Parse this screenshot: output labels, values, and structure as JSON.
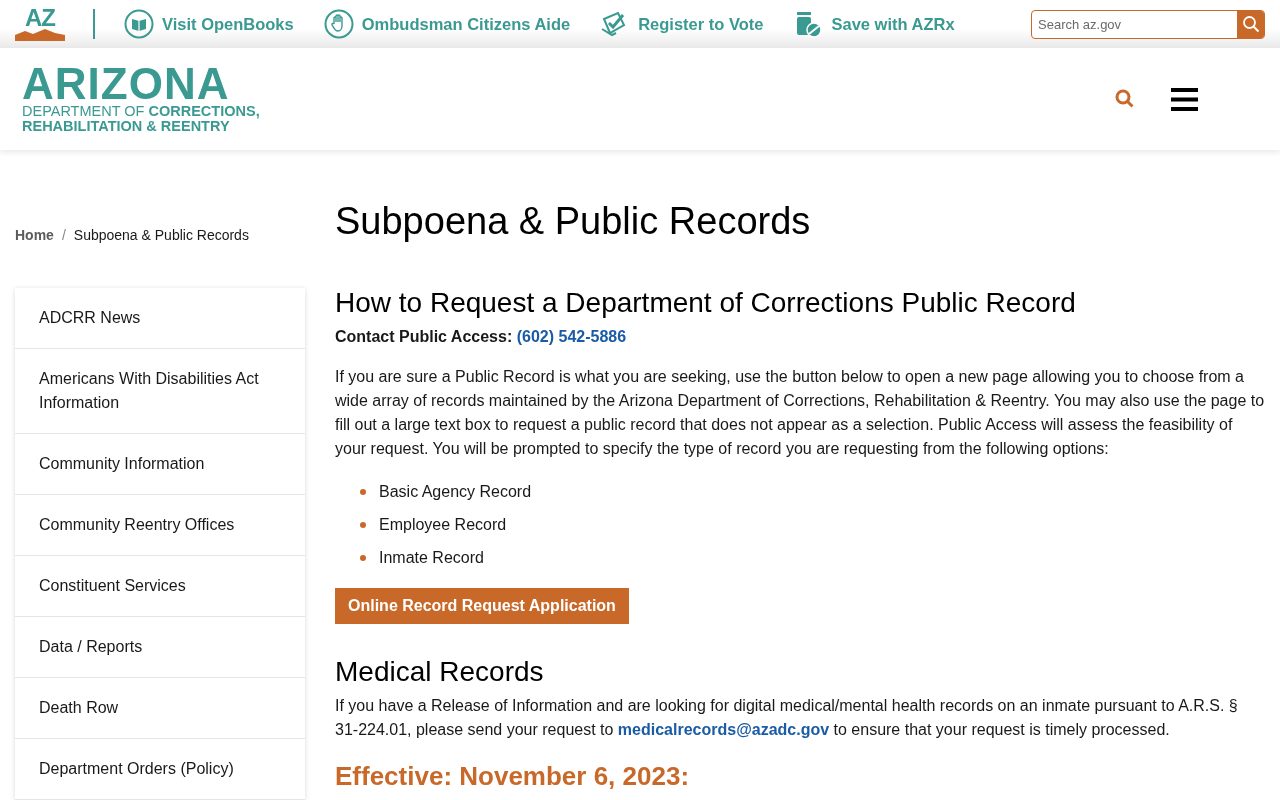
{
  "top_bar": {
    "logo": "AZ",
    "links": [
      {
        "label": "Visit OpenBooks",
        "kind": "book"
      },
      {
        "label": "Ombudsman Citizens Aide",
        "kind": "hand"
      },
      {
        "label": "Register to Vote",
        "kind": "vote"
      },
      {
        "label": "Save with AZRx",
        "kind": "pill"
      }
    ],
    "search": {
      "placeholder": "Search az.gov"
    }
  },
  "header": {
    "logo": {
      "name": "ARIZONA",
      "line_1_light": "DEPARTMENT OF",
      "line_1_bold": "CORRECTIONS,",
      "line_2": "REHABILITATION & REENTRY"
    }
  },
  "breadcrumb": [
    {
      "label": "Home",
      "kind": "link"
    },
    {
      "label": "/",
      "kind": "separator"
    },
    {
      "label": "Subpoena & Public Records",
      "kind": "current"
    }
  ],
  "sidebar": {
    "items": [
      "ADCRR News",
      "Americans With Disabilities Act Information",
      "Community Information",
      "Community Reentry Offices",
      "Constituent Services",
      "Data / Reports",
      "Death Row",
      "Department Orders (Policy)"
    ]
  },
  "main": {
    "title": "Subpoena & Public Records",
    "sections": [
      {
        "heading": "How to Request a Department of Corrections Public Record",
        "contact_label": "Contact Public Access:",
        "contact_link": "(602) 542-5886",
        "paragraph": "If you are sure a Public Record is what you are seeking, use the button below to open a new page allowing you to choose from a wide array of records maintained by the Arizona Department of Corrections, Rehabilitation & Reentry. You may also use the page to fill out a large text box to request a public record that does not appear as a selection. Public Access will assess the feasibility of your request. You will be prompted to specify the type of record you are requesting from the following options:",
        "bullets": [
          "Basic Agency Record",
          "Employee Record",
          "Inmate Record"
        ],
        "button": "Online Record Request Application"
      },
      {
        "heading": "Medical Records",
        "paragraph_before": "If you have a Release of Information and are looking for digital medical/mental health records on an inmate pursuant to A.R.S. § 31-224.01, please send your request to",
        "link": "medicalrecords@azadc.gov",
        "paragraph_after": "to ensure that your request is timely processed."
      }
    ],
    "next_heading": "Effective: November 6, 2023:"
  }
}
